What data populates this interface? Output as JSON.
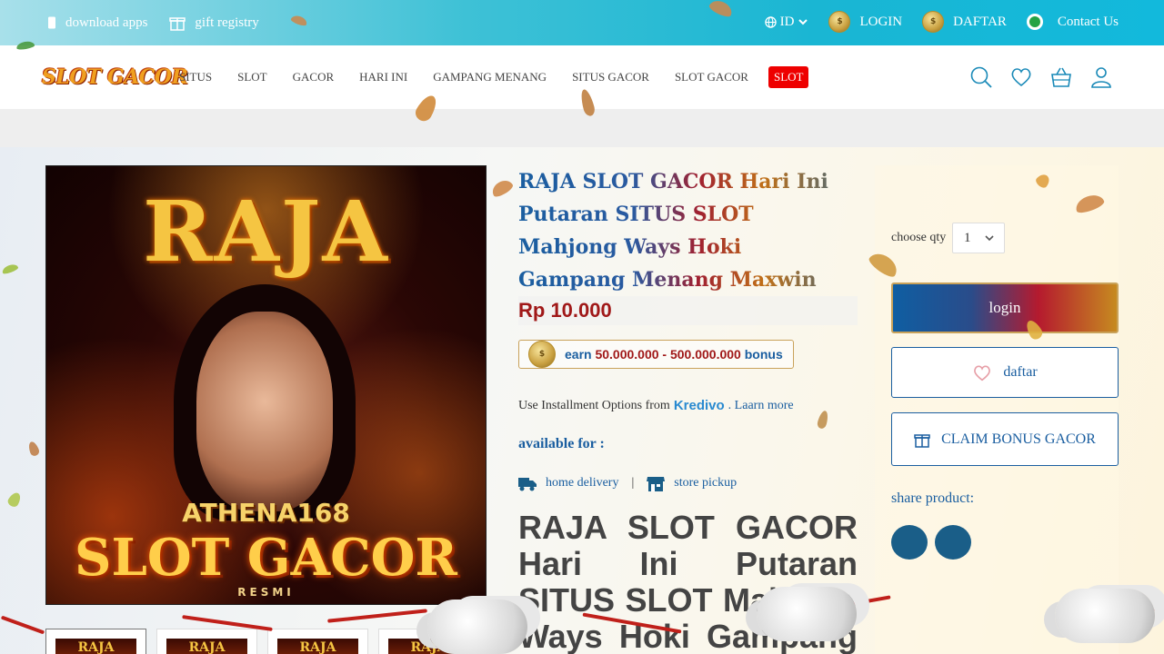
{
  "topbar": {
    "download_apps": "download apps",
    "gift_registry": "gift registry",
    "language": "ID",
    "login": "LOGIN",
    "daftar": "DAFTAR",
    "contact": "Contact Us"
  },
  "nav": {
    "logo": "SLOT GACOR",
    "menu": [
      "SITUS",
      "SLOT",
      "GACOR",
      "HARI INI",
      "GAMPANG MENANG",
      "SITUS GACOR",
      "SLOT GACOR"
    ],
    "hot": "SLOT"
  },
  "product": {
    "image": {
      "title": "RAJA",
      "brand": "ATHENA168",
      "subtitle": "SLOT GACOR",
      "tag": "RESMI"
    },
    "thumb_label": "RAJA",
    "title": "RAJA SLOT GACOR Hari Ini Putaran SITUS SLOT Mahjong Ways Hoki Gampang Menang Maxwin",
    "price": "Rp 10.000",
    "bonus": {
      "prefix": "earn",
      "range": "50.000.000 - 500.000.000",
      "suffix": "bonus"
    },
    "installment_text": "Use Installment Options from",
    "kredivo": "Kredivo",
    "learn_more": ". Laarn more",
    "available_for": "available for :",
    "home_delivery": "home delivery",
    "separator": "|",
    "store_pickup": "store pickup",
    "big_title": "RAJA SLOT GACOR Hari Ini Putaran SITUS SLOT Mahjong Ways Hoki Gampang"
  },
  "sidebar": {
    "qty_label": "choose qty",
    "qty_value": "1",
    "login_button": "login",
    "daftar_button": "daftar",
    "claim_button": "CLAIM BONUS GACOR",
    "share_label": "share product:"
  },
  "colors": {
    "brand_blue": "#1a5ea0",
    "price_red": "#a01818",
    "gold": "#c9a25a",
    "topbar": "#12b9dc"
  }
}
